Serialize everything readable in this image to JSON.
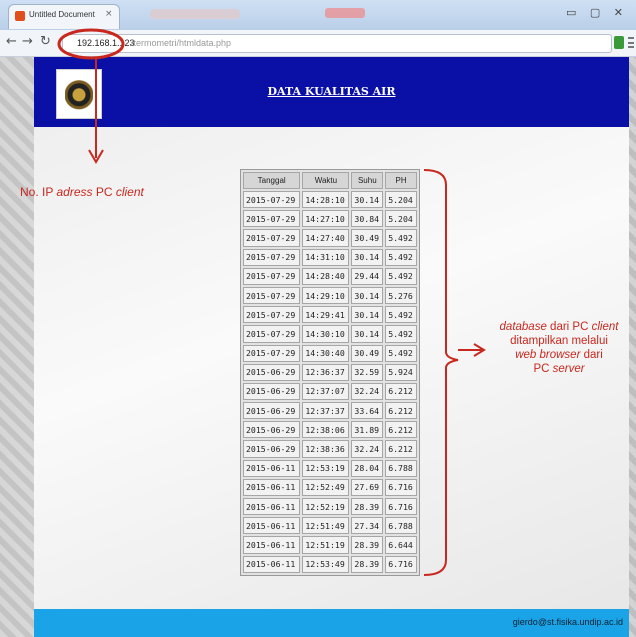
{
  "browser": {
    "tab_title": "Untitled Document",
    "tab_close": "×",
    "url_ip": "192.168.1.123",
    "url_path": "/termometri/htmldata.php",
    "window_buttons": "▭ ▢ ✕"
  },
  "page": {
    "title": "DATA KUALITAS AIR",
    "footer_email": "gierdo@st.fisika.undip.ac.id"
  },
  "table": {
    "headers": [
      "Tanggal",
      "Waktu",
      "Suhu",
      "PH"
    ],
    "rows": [
      [
        "2015-07-29",
        "14:28:10",
        "30.14",
        "5.204"
      ],
      [
        "2015-07-29",
        "14:27:10",
        "30.84",
        "5.204"
      ],
      [
        "2015-07-29",
        "14:27:40",
        "30.49",
        "5.492"
      ],
      [
        "2015-07-29",
        "14:31:10",
        "30.14",
        "5.492"
      ],
      [
        "2015-07-29",
        "14:28:40",
        "29.44",
        "5.492"
      ],
      [
        "2015-07-29",
        "14:29:10",
        "30.14",
        "5.276"
      ],
      [
        "2015-07-29",
        "14:29:41",
        "30.14",
        "5.492"
      ],
      [
        "2015-07-29",
        "14:30:10",
        "30.14",
        "5.492"
      ],
      [
        "2015-07-29",
        "14:30:40",
        "30.49",
        "5.492"
      ],
      [
        "2015-06-29",
        "12:36:37",
        "32.59",
        "5.924"
      ],
      [
        "2015-06-29",
        "12:37:07",
        "32.24",
        "6.212"
      ],
      [
        "2015-06-29",
        "12:37:37",
        "33.64",
        "6.212"
      ],
      [
        "2015-06-29",
        "12:38:06",
        "31.89",
        "6.212"
      ],
      [
        "2015-06-29",
        "12:38:36",
        "32.24",
        "6.212"
      ],
      [
        "2015-06-11",
        "12:53:19",
        "28.04",
        "6.788"
      ],
      [
        "2015-06-11",
        "12:52:49",
        "27.69",
        "6.716"
      ],
      [
        "2015-06-11",
        "12:52:19",
        "28.39",
        "6.716"
      ],
      [
        "2015-06-11",
        "12:51:49",
        "27.34",
        "6.788"
      ],
      [
        "2015-06-11",
        "12:51:19",
        "28.39",
        "6.644"
      ],
      [
        "2015-06-11",
        "12:53:49",
        "28.39",
        "6.716"
      ]
    ]
  },
  "annotations": {
    "ip_label_prefix": "No. IP ",
    "ip_label_italic": "adress",
    "ip_label_mid": " PC ",
    "ip_label_italic2": "client",
    "db_line1_italic": "database",
    "db_line1_rest": " dari PC ",
    "db_line1_italic2": "client",
    "db_line2": "ditampilkan melalui",
    "db_line3_italic": "web browser",
    "db_line3_rest": " dari",
    "db_line4": "PC ",
    "db_line4_italic": "server",
    "color": "#c8281e"
  }
}
